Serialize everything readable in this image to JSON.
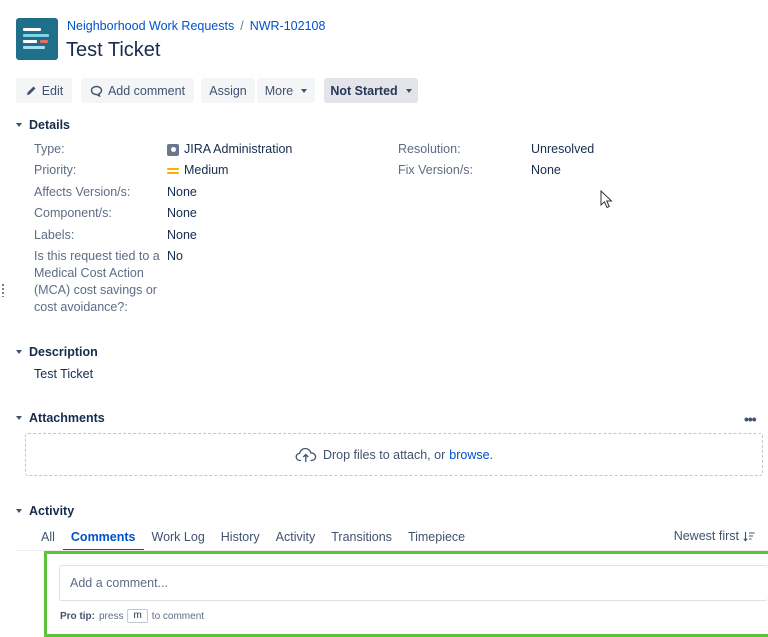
{
  "header": {
    "project_link": "Neighborhood Work Requests",
    "separator": "/",
    "issue_key": "NWR-102108",
    "title": "Test Ticket"
  },
  "toolbar": {
    "edit_label": "Edit",
    "add_comment_label": "Add comment",
    "assign_label": "Assign",
    "more_label": "More",
    "status_label": "Not Started"
  },
  "details": {
    "heading": "Details",
    "left_fields": [
      {
        "label": "Type:",
        "value": "JIRA Administration"
      },
      {
        "label": "Priority:",
        "value": "Medium"
      },
      {
        "label": "Affects Version/s:",
        "value": "None"
      },
      {
        "label": "Component/s:",
        "value": "None"
      },
      {
        "label": "Labels:",
        "value": "None"
      },
      {
        "label": "Is this request tied to a Medical Cost Action (MCA) cost savings or cost avoidance?:",
        "value": "No"
      }
    ],
    "right_fields": [
      {
        "label": "Resolution:",
        "value": "Unresolved"
      },
      {
        "label": "Fix Version/s:",
        "value": "None"
      }
    ]
  },
  "description": {
    "heading": "Description",
    "text": "Test Ticket"
  },
  "attachments": {
    "heading": "Attachments",
    "drop_text": "Drop files to attach, or",
    "browse_link": "browse",
    "period": "."
  },
  "activity": {
    "heading": "Activity",
    "tabs": [
      "All",
      "Comments",
      "Work Log",
      "History",
      "Activity",
      "Transitions",
      "Timepiece"
    ],
    "active_tab": "Comments",
    "sort_label": "Newest first",
    "comment_placeholder": "Add a comment...",
    "protip_prefix": "Pro tip:",
    "protip_press": "press",
    "protip_key": "m",
    "protip_suffix": "to comment"
  },
  "colors": {
    "link": "#0052cc",
    "highlight": "#5ec23a",
    "priority_medium": "#ffab00"
  }
}
